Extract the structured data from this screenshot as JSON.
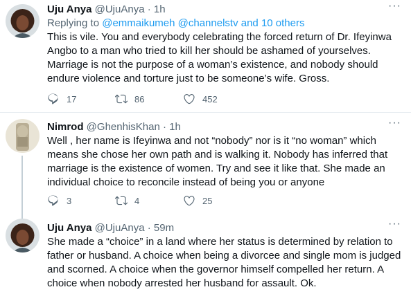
{
  "tweets": [
    {
      "name": "Uju Anya",
      "handle": "@UjuAnya",
      "time": "1h",
      "reply_prefix": "Replying to",
      "reply_mentions": "@emmaikumeh @channelstv and 10 others",
      "text": "This is vile. You and everybody celebrating the forced return of Dr. Ifeyinwa Angbo to a man who tried to kill her should be ashamed of yourselves. Marriage is not the purpose of a woman’s existence, and nobody should endure violence and torture just to be someone’s wife. Gross.",
      "replies": "17",
      "retweets": "86",
      "likes": "452"
    },
    {
      "name": "Nimrod",
      "handle": "@GhenhisKhan",
      "time": "1h",
      "text": "Well , her name is Ifeyinwa and not “nobody” nor is it “no woman” which means she chose her own path and is walking it. Nobody has inferred that marriage is the existence of women. Try and see it like that. She made an individual choice to reconcile instead of being you or anyone",
      "replies": "3",
      "retweets": "4",
      "likes": "25"
    },
    {
      "name": "Uju Anya",
      "handle": "@UjuAnya",
      "time": "59m",
      "text": "She made a “choice” in a land where her status is determined by relation to father or husband. A choice when being a divorcee and single mom is judged and scorned. A choice when the governor himself compelled her return. A choice when nobody arrested her husband for assault. Ok."
    }
  ],
  "separator": "·",
  "colors": {
    "accent": "#1d9bf0",
    "secondary_text": "#536471",
    "divider": "#e6ecf0"
  },
  "icons": [
    "reply-icon",
    "retweet-icon",
    "like-icon",
    "more-icon"
  ]
}
